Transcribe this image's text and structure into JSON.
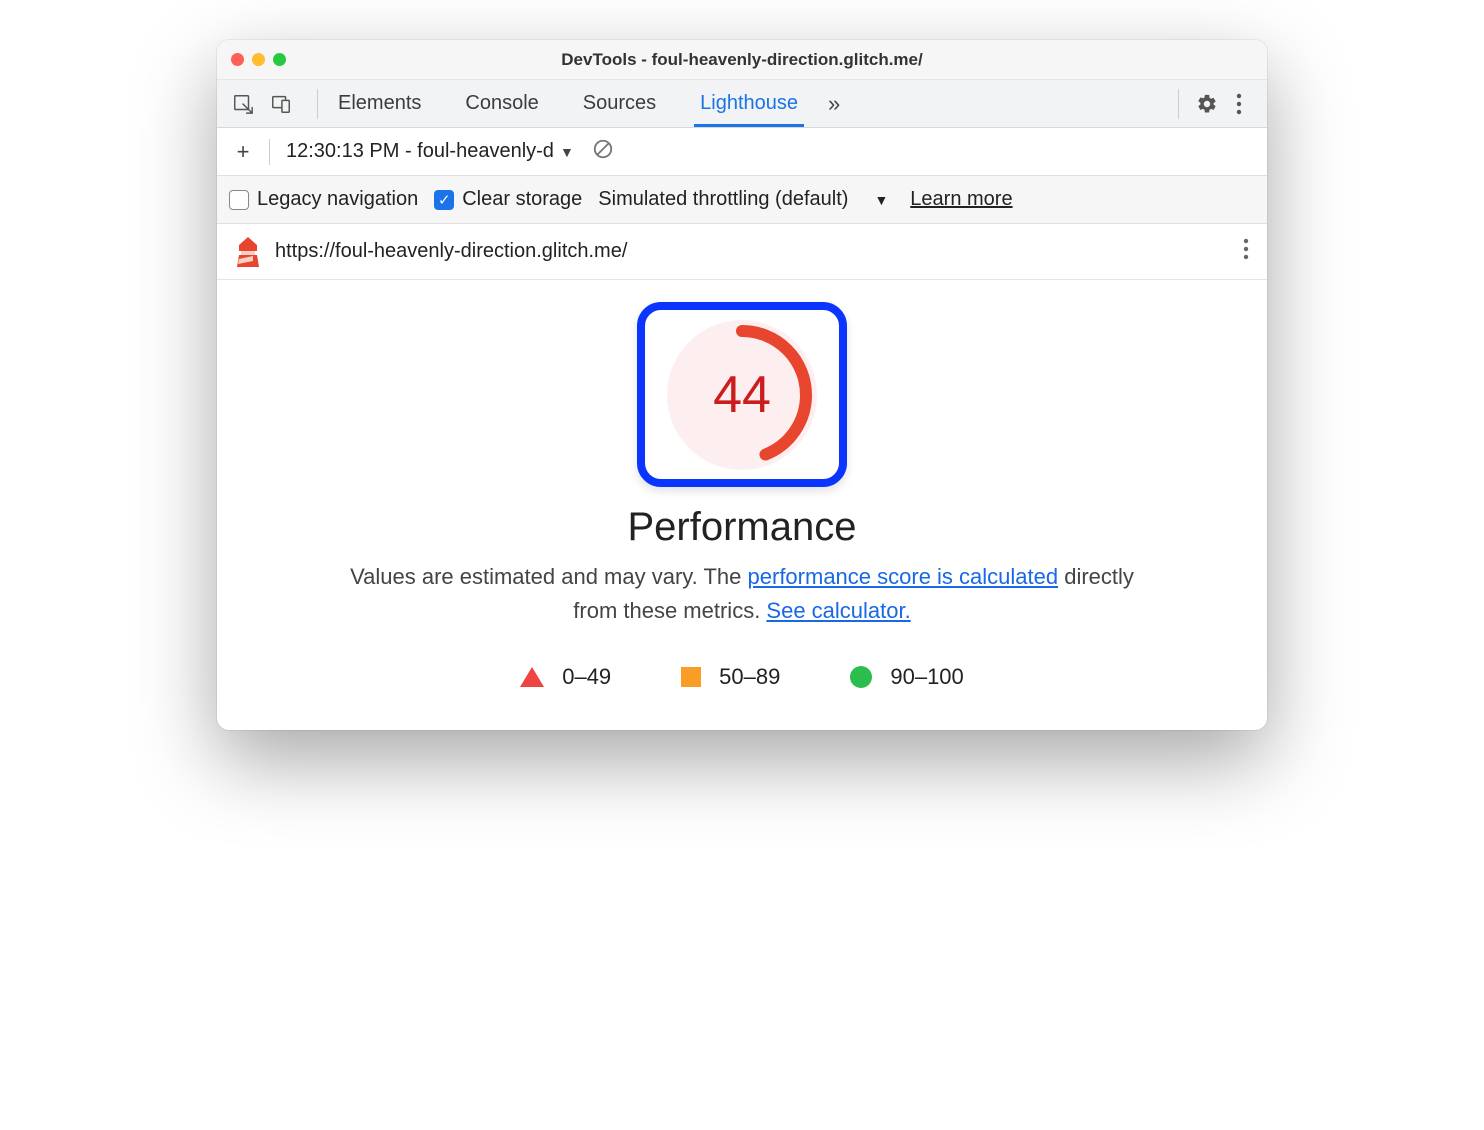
{
  "window_title": "DevTools - foul-heavenly-direction.glitch.me/",
  "tabs": {
    "elements": "Elements",
    "console": "Console",
    "sources": "Sources",
    "lighthouse": "Lighthouse"
  },
  "report_dropdown": "12:30:13 PM - foul-heavenly-d",
  "options": {
    "legacy_label": "Legacy navigation",
    "clear_label": "Clear storage",
    "throttling_label": "Simulated throttling (default)",
    "learn_more": "Learn more"
  },
  "report_url": "https://foul-heavenly-direction.glitch.me/",
  "gauge_score": "44",
  "gauge_pct": 44,
  "report_title": "Performance",
  "report_desc_prefix": "Values are estimated and may vary. The ",
  "report_desc_link1": "performance score is calculated",
  "report_desc_mid": " directly from these metrics. ",
  "report_desc_link2": "See calculator.",
  "legend": {
    "bad": "0–49",
    "mid": "50–89",
    "good": "90–100"
  },
  "colors": {
    "fail_red": "#ef4444",
    "warn_orange": "#fa9d27",
    "pass_green": "#2bbd4e",
    "highlight_blue": "#0b35ff"
  }
}
